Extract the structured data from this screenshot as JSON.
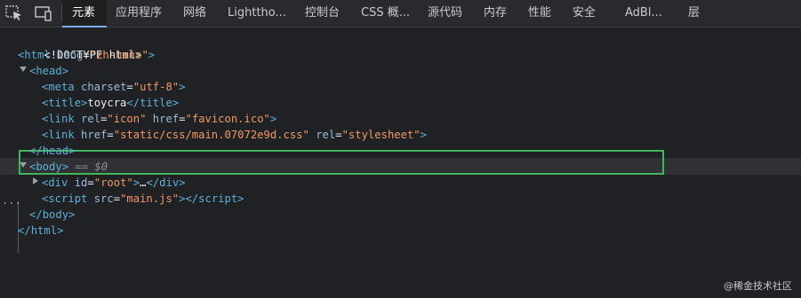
{
  "toolbar": {
    "tabs": [
      "元素",
      "应用程序",
      "网络",
      "Lighttho...",
      "控制台",
      "CSS 概...",
      "源代码",
      "内存",
      "性能",
      "安全",
      "AdBl...",
      "层"
    ]
  },
  "code": {
    "doctype": "<!DOCTYPE html>",
    "html_tag": "html",
    "lang_attr": "lang",
    "lang_val": "\"zh-hans\"",
    "head_tag": "head",
    "meta_tag": "meta",
    "charset_attr": "charset",
    "charset_val": "\"utf-8\"",
    "title_tag": "title",
    "title_text": "toycra",
    "link_tag": "link",
    "rel_attr": "rel",
    "icon_val": "\"icon\"",
    "href_attr": "href",
    "favicon_val": "\"favicon.ico\"",
    "css_href_val": "\"static/css/main.07072e9d.css\"",
    "stylesheet_val": "\"stylesheet\"",
    "body_tag": "body",
    "body_suffix": " == $0",
    "div_tag": "div",
    "id_attr": "id",
    "root_val": "\"root\"",
    "collapsed": "…",
    "script_tag": "script",
    "src_attr": "src",
    "main_js_val": "\"main.js\""
  },
  "watermark": "@稀金技术社区"
}
